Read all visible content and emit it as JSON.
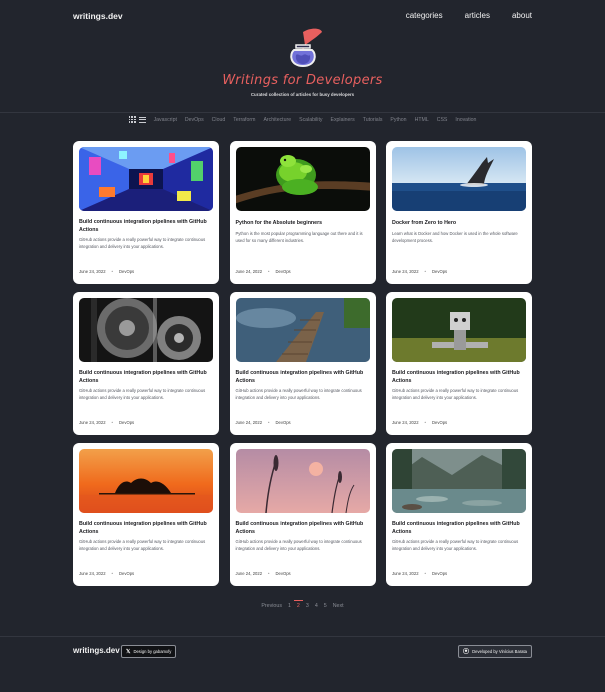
{
  "header": {
    "brand": "writings.dev",
    "nav": [
      "categories",
      "articles",
      "about"
    ]
  },
  "hero": {
    "logo_icon": "ink-quill-icon",
    "title": "Writings for Developers",
    "subtitle": "Curated collection of articles for busy developers"
  },
  "tags": [
    "Javascript",
    "DevOps",
    "Cloud",
    "Terraform",
    "Architecture",
    "Scalability",
    "Explainers",
    "Tutorials",
    "Python",
    "HTML",
    "CSS",
    "Inovation"
  ],
  "view_icons": [
    "grid-view-icon",
    "list-view-icon"
  ],
  "articles": [
    {
      "title": "Build continuous integration pipelines with GitHub Actions",
      "desc": "GitHub actions provide a really powerful way to integrate continuous integration and delivery into your applications.",
      "date": "June 24, 2022",
      "category": "DevOps",
      "image": "colorful-corridor"
    },
    {
      "title": "Python for the Absolute beginners",
      "desc": "Python is the most popular programming language out there and it is used for so many different industries.",
      "date": "June 24, 2022",
      "category": "DevOps",
      "image": "green-python-snake"
    },
    {
      "title": "Docker from Zero to Hero",
      "desc": "Learn what is Docker and how Docker is used in the whole software development process.",
      "date": "June 24, 2022",
      "category": "DevOps",
      "image": "whale-tail-ocean"
    },
    {
      "title": "Build continuous integration pipelines with GitHub Actions",
      "desc": "GitHub actions provide a really powerful way to integrate continuous integration and delivery into your applications.",
      "date": "June 24, 2022",
      "category": "DevOps",
      "image": "gears"
    },
    {
      "title": "Build continuous integration pipelines with GitHub Actions",
      "desc": "GitHub actions provide a really powerful way to integrate continuous integration and delivery into your applications.",
      "date": "June 24, 2022",
      "category": "DevOps",
      "image": "wooden-boardwalk"
    },
    {
      "title": "Build continuous integration pipelines with GitHub Actions",
      "desc": "GitHub actions provide a really powerful way to integrate continuous integration and delivery into your applications.",
      "date": "June 24, 2022",
      "category": "DevOps",
      "image": "robot-in-field"
    },
    {
      "title": "Build continuous integration pipelines with GitHub Actions",
      "desc": "GitHub actions provide a really powerful way to integrate continuous integration and delivery into your applications.",
      "date": "June 24, 2022",
      "category": "DevOps",
      "image": "sunset-island"
    },
    {
      "title": "Build continuous integration pipelines with GitHub Actions",
      "desc": "GitHub actions provide a really powerful way to integrate continuous integration and delivery into your applications.",
      "date": "June 24, 2022",
      "category": "DevOps",
      "image": "pink-sunset-grass"
    },
    {
      "title": "Build continuous integration pipelines with GitHub Actions",
      "desc": "GitHub actions provide a really powerful way to integrate continuous integration and delivery into your applications.",
      "date": "June 24, 2022",
      "category": "DevOps",
      "image": "mountain-river"
    }
  ],
  "pagination": {
    "previous": "Previous",
    "pages": [
      "1",
      "2",
      "3",
      "4",
      "5"
    ],
    "current": "2",
    "next": "Next"
  },
  "footer": {
    "brand": "writings.dev",
    "design_badge": "Design by gabamxfy",
    "dev_badge": "Developed by Vinícius Barata"
  },
  "colors": {
    "background": "#22252d",
    "accent": "#e8605f",
    "card": "#ffffff"
  }
}
